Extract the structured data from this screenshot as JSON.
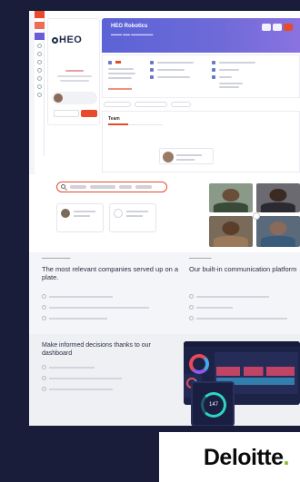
{
  "app": {
    "company_name": "HEO Robotics",
    "logo_text": "HEO",
    "team_heading": "Team",
    "gauge_value": "147"
  },
  "features": {
    "companies_heading": "The most relevant companies served up on a plate.",
    "communication_heading": "Our built-in communication platform",
    "dashboard_heading": "Make informed decisions thanks to our dashboard"
  },
  "brand": {
    "name": "Deloitte",
    "dot_color": "#86bc25"
  },
  "colors": {
    "page_bg": "#1a1d3a",
    "accent": "#e84a2a",
    "header_gradient_start": "#5b63d6",
    "dashboard_bg": "#1d2347"
  }
}
